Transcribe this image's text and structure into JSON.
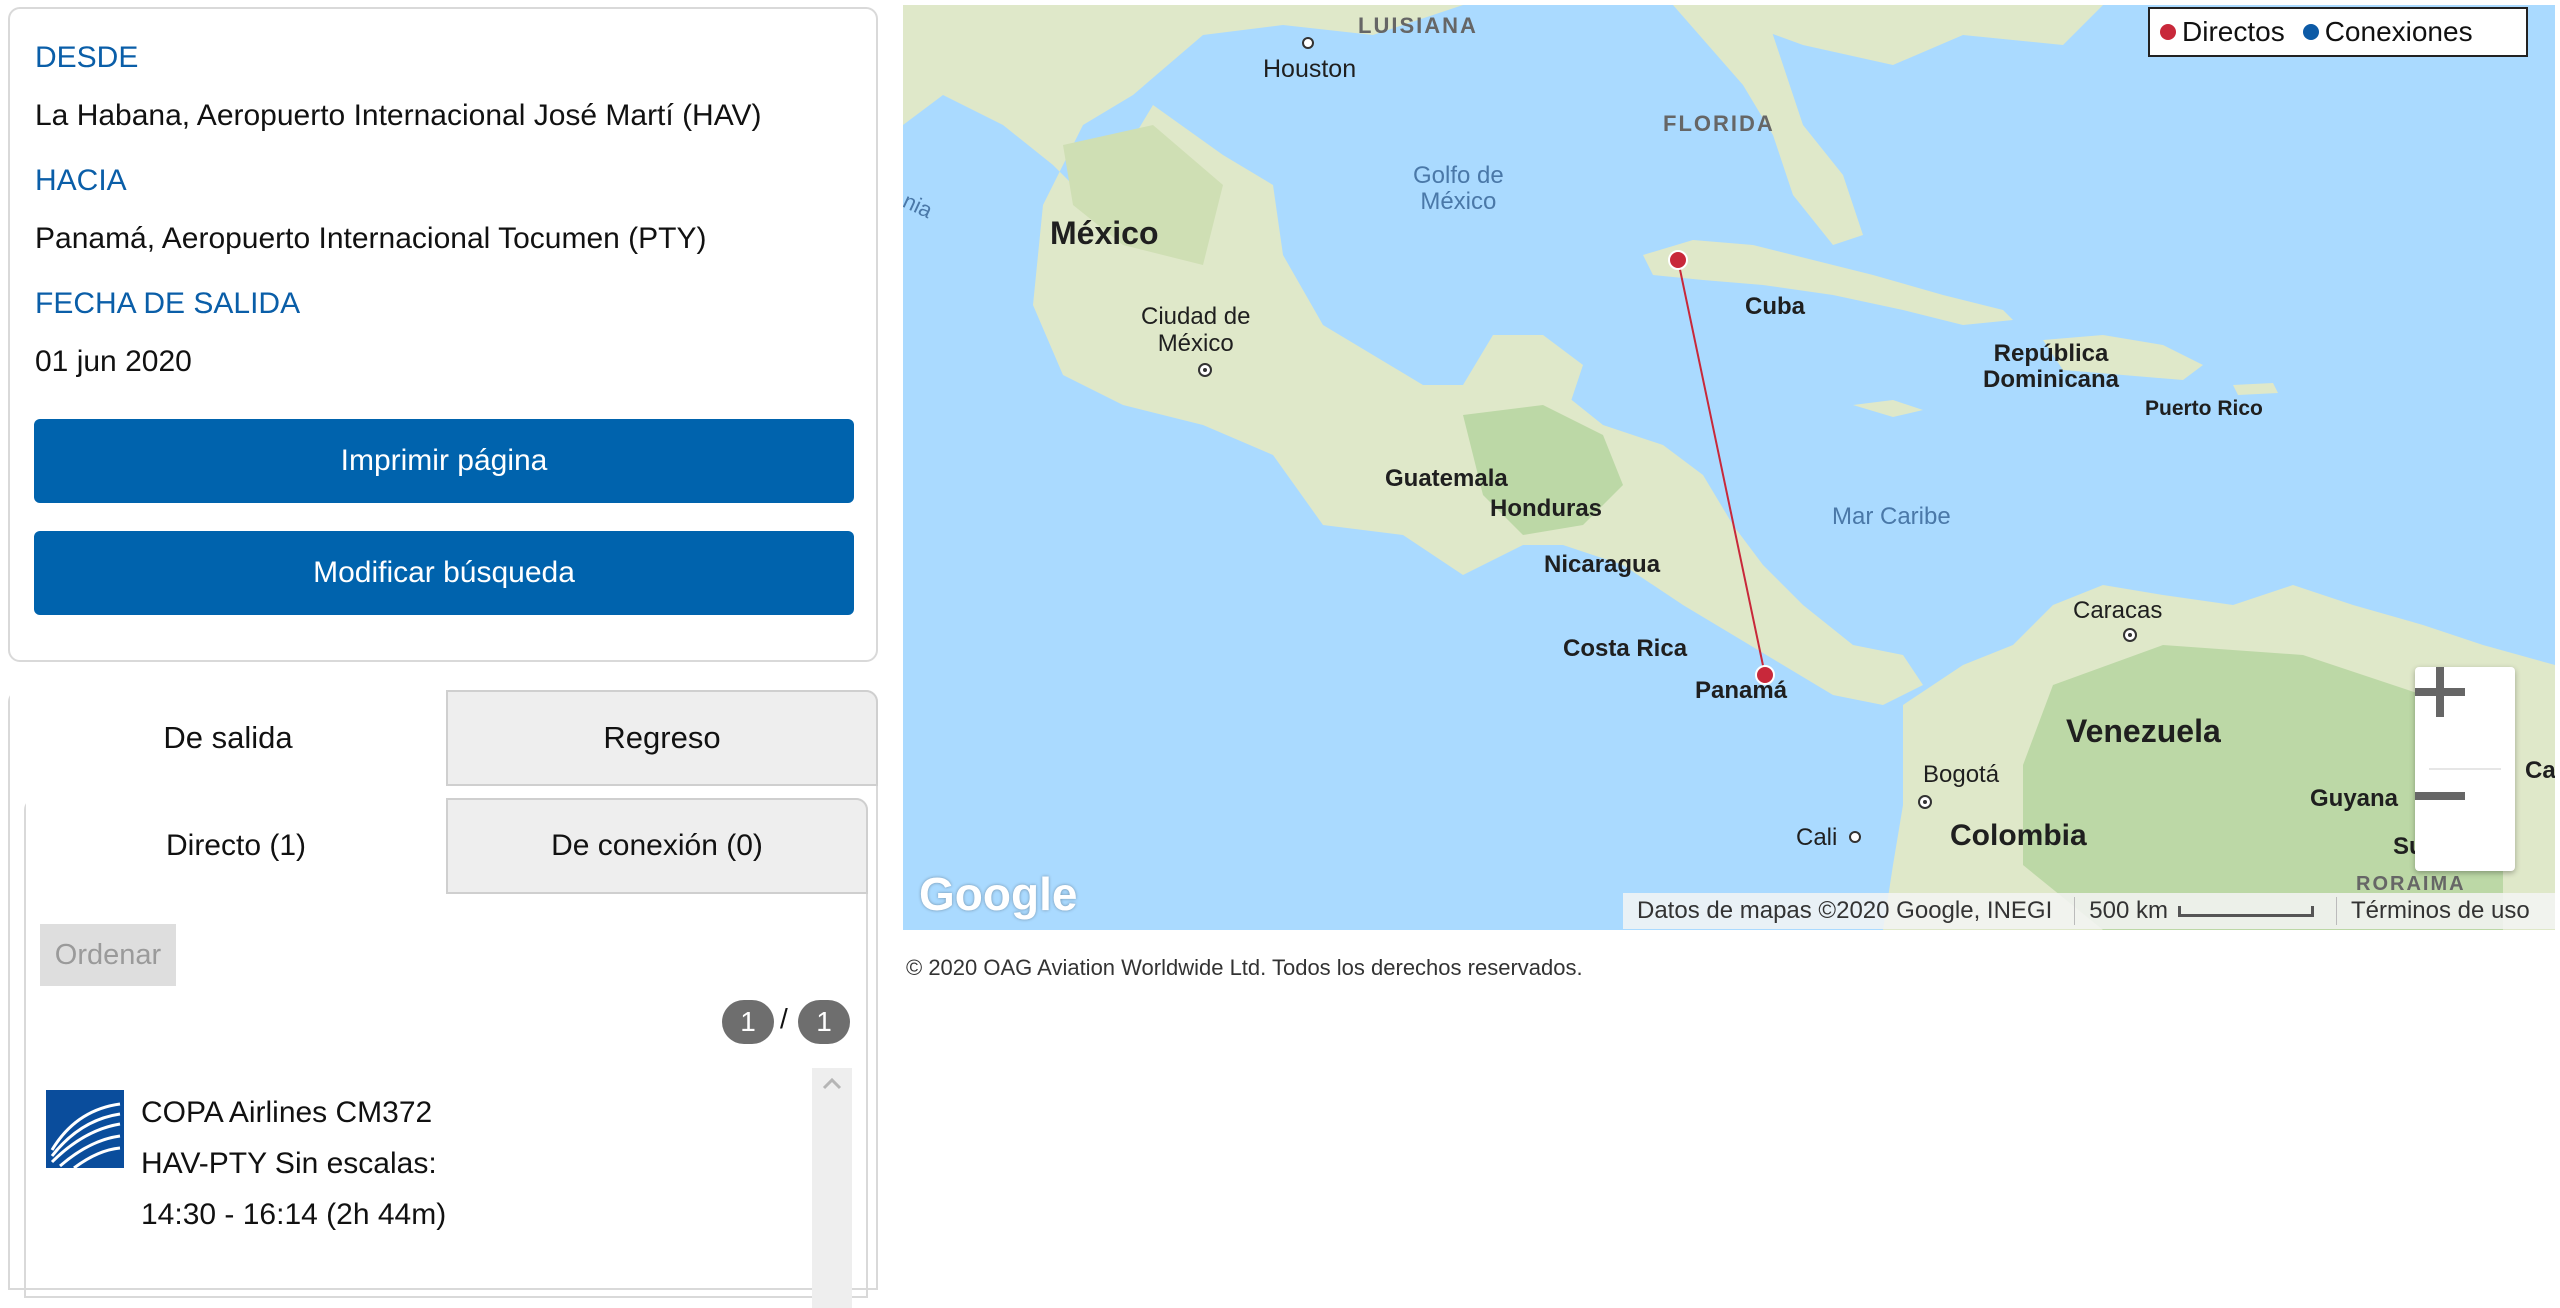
{
  "search": {
    "from_label": "DESDE",
    "from_value": "La Habana, Aeropuerto Internacional José Martí (HAV)",
    "to_label": "HACIA",
    "to_value": "Panamá, Aeropuerto Internacional Tocumen (PTY)",
    "date_label": "FECHA DE SALIDA",
    "date_value": "01 jun 2020",
    "print_button": "Imprimir página",
    "modify_button": "Modificar búsqueda"
  },
  "results": {
    "tabs": [
      {
        "label": "De salida",
        "active": true
      },
      {
        "label": "Regreso",
        "active": false
      }
    ],
    "subtabs": [
      {
        "label": "Directo (1)",
        "active": true
      },
      {
        "label": "De conexión (0)",
        "active": false
      }
    ],
    "order_button": "Ordenar",
    "page_current": "1",
    "page_separator": "/",
    "page_total": "1",
    "flights": [
      {
        "airline": "COPA Airlines CM372",
        "route": "HAV-PTY Sin escalas:",
        "times": "14:30 - 16:14 (2h 44m)"
      }
    ]
  },
  "map": {
    "legend": [
      {
        "label": "Directos",
        "color": "#c8283a"
      },
      {
        "label": "Conexiones",
        "color": "#0c5aa6"
      }
    ],
    "labels": {
      "luisiana": "LUISIANA",
      "houston": "Houston",
      "florida": "FLORIDA",
      "golfo": "Golfo de\nMéxico",
      "mexico": "México",
      "ciudad_mexico": "Ciudad de\nMéxico",
      "cuba": "Cuba",
      "republica_dominicana": "República\nDominicana",
      "puerto_rico": "Puerto Rico",
      "guatemala": "Guatemala",
      "honduras": "Honduras",
      "nicaragua": "Nicaragua",
      "mar_caribe": "Mar Caribe",
      "costa_rica": "Costa Rica",
      "panama": "Panamá",
      "caracas": "Caracas",
      "venezuela": "Venezuela",
      "bogota": "Bogotá",
      "colombia": "Colombia",
      "cali": "Cali",
      "guyana": "Guyana",
      "roraima": "RORAIMA",
      "sur": "Sur",
      "cay": "Cay",
      "nia": "nia"
    },
    "logo": "Google",
    "attribution": "Datos de mapas ©2020 Google, INEGI",
    "scale": "500 km",
    "terms": "Términos de uso",
    "route_color": "#c8283a",
    "water_color": "#aadaff",
    "land_color": "#dfe8c9"
  },
  "footer": {
    "copyright": "© 2020 OAG Aviation Worldwide Ltd. Todos los derechos reservados."
  }
}
